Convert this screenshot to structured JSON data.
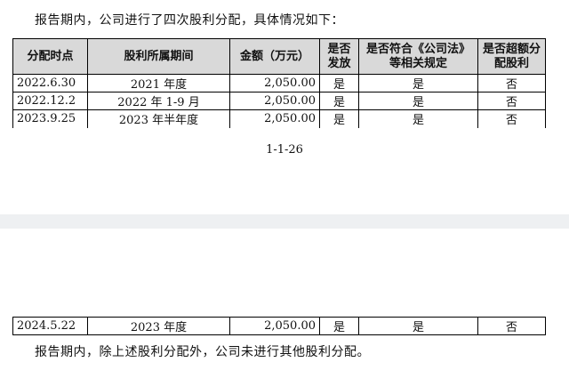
{
  "intro_text": "报告期内，公司进行了四次股利分配，具体情况如下：",
  "table": {
    "headers": [
      "分配时点",
      "股利所属期间",
      "金额（万元）",
      "是否\n发放",
      "是否符合《公司法》\n等相关规定",
      "是否超额分\n配股利"
    ],
    "rows": [
      [
        "2022.6.30",
        "2021 年度",
        "2,050.00",
        "是",
        "是",
        "否"
      ],
      [
        "2022.12.2",
        "2022 年 1-9 月",
        "2,050.00",
        "是",
        "是",
        "否"
      ],
      [
        "2023.9.25",
        "2023 年半年度",
        "2,050.00",
        "是",
        "是",
        "否"
      ]
    ],
    "continued_rows": [
      [
        "2024.5.22",
        "2023 年度",
        "2,050.00",
        "是",
        "是",
        "否"
      ]
    ]
  },
  "page_number": "1-1-26",
  "outro_text": "报告期内，除上述股利分配外，公司未进行其他股利分配。"
}
